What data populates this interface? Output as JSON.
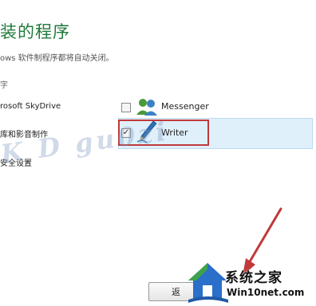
{
  "header": {
    "title": "装的程序",
    "subtitle": "ows 软件制程序都将自动关闭。"
  },
  "section": {
    "label": "字"
  },
  "left_items": [
    {
      "label": "rosoft SkyDrive"
    },
    {
      "label": "库和影音制作"
    },
    {
      "label": "安全设置"
    }
  ],
  "apps": [
    {
      "name": "Messenger",
      "checked": false,
      "icon": "messenger-icon"
    },
    {
      "name": "Writer",
      "checked": true,
      "check_glyph": "✓",
      "icon": "writer-pen-icon"
    }
  ],
  "watermark": {
    "text": "K D  gu0zi"
  },
  "footer": {
    "back_label": "返"
  },
  "logo": {
    "cn": "系统之家",
    "en": "Win10net.com"
  },
  "colors": {
    "title": "#1f7a3a",
    "highlight": "#dff0fb",
    "annotation": "#c0393b"
  }
}
